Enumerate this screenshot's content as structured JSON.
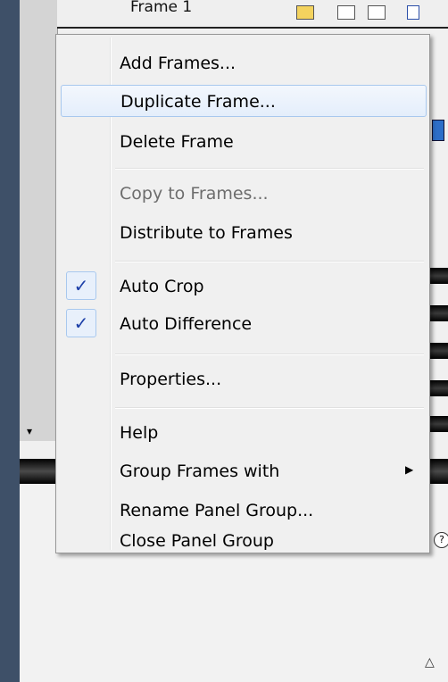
{
  "background": {
    "frame_label": "Frame 1"
  },
  "menu": {
    "items": [
      {
        "label": "Add Frames..."
      },
      {
        "label": "Duplicate Frame..."
      },
      {
        "label": "Delete Frame"
      },
      {
        "label": "Copy to Frames..."
      },
      {
        "label": "Distribute to Frames"
      },
      {
        "label": "Auto Crop",
        "checked": true
      },
      {
        "label": "Auto Difference",
        "checked": true
      },
      {
        "label": "Properties..."
      },
      {
        "label": "Help"
      },
      {
        "label": "Group Frames with"
      },
      {
        "label": "Rename Panel Group..."
      },
      {
        "label": "Close Panel Group"
      }
    ],
    "check_glyph": "✓",
    "submenu_glyph": "▶"
  },
  "icons": {
    "dropdown": "▾",
    "help": "?",
    "collapse": "△"
  },
  "colors": {
    "highlight_border": "#a8c8ee",
    "check": "#1c3fa8",
    "desktop": "#3e5068"
  }
}
